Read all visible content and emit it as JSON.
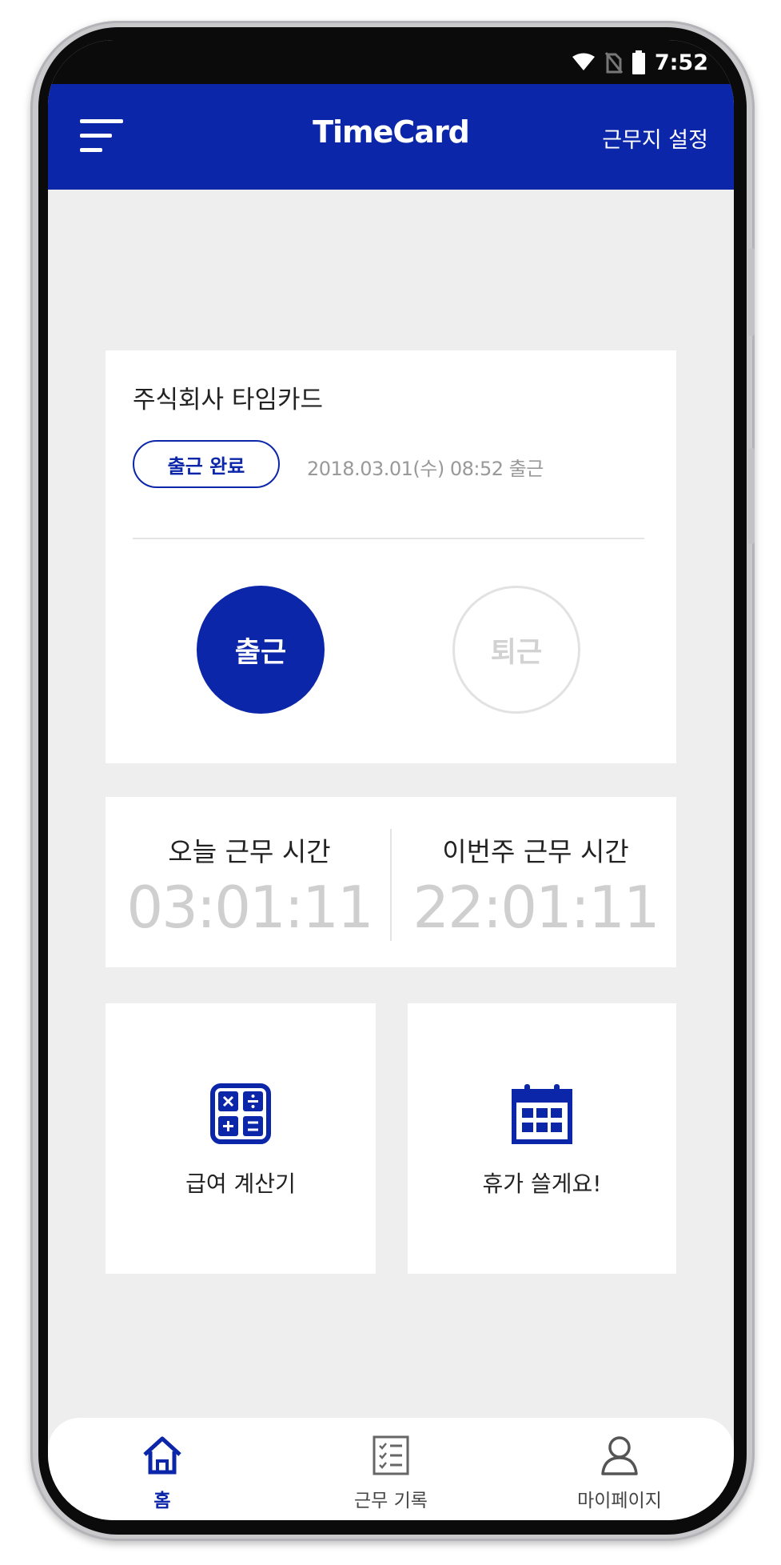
{
  "status_bar": {
    "time": "7:52"
  },
  "app_bar": {
    "title": "TimeCard",
    "workplace_setting": "근무지 설정"
  },
  "attendance_card": {
    "company_name": "주식회사 타임카드",
    "status_badge": "출근 완료",
    "checkin_time": "2018.03.01(수) 08:52 출근",
    "check_in_label": "출근",
    "check_out_label": "퇴근"
  },
  "work_time": {
    "today_label": "오늘 근무 시간",
    "today_value": "03:01:11",
    "week_label": "이번주 근무 시간",
    "week_value": "22:01:11"
  },
  "tiles": {
    "calculator_label": "급여 계산기",
    "vacation_label": "휴가 쓸게요!"
  },
  "bottom_nav": {
    "items": [
      {
        "label": "홈",
        "icon": "home-icon",
        "active": true
      },
      {
        "label": "근무 기록",
        "icon": "checklist-icon",
        "active": false
      },
      {
        "label": "마이페이지",
        "icon": "person-icon",
        "active": false
      }
    ]
  },
  "colors": {
    "primary": "#0b26a9",
    "background": "#eeeeee",
    "muted": "#cfcfcf"
  }
}
